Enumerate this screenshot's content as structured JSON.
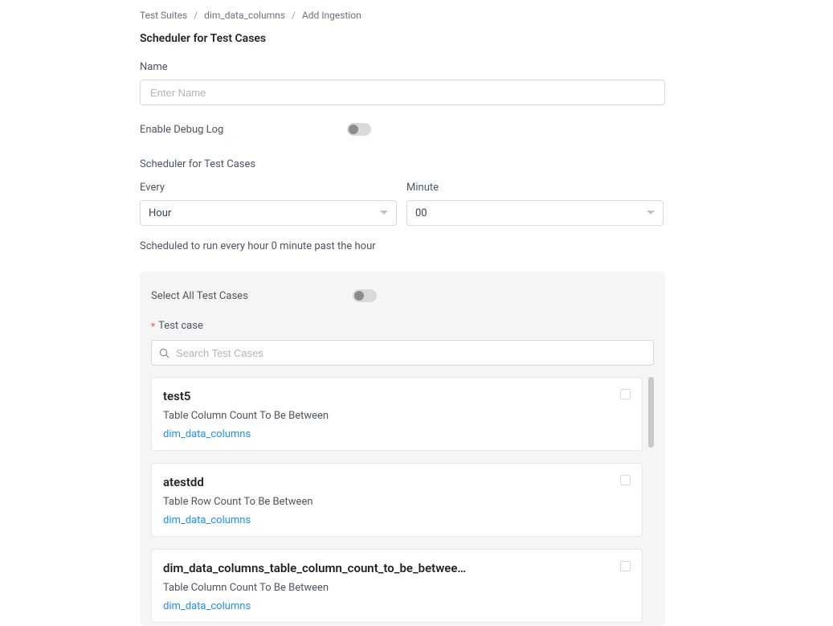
{
  "breadcrumb": {
    "items": [
      "Test Suites",
      "dim_data_columns",
      "Add Ingestion"
    ]
  },
  "header": {
    "title": "Scheduler for Test Cases"
  },
  "form": {
    "name_label": "Name",
    "name_placeholder": "Enter Name",
    "debug_log_label": "Enable Debug Log",
    "scheduler_heading": "Scheduler for Test Cases",
    "every_label": "Every",
    "every_value": "Hour",
    "minute_label": "Minute",
    "minute_value": "00",
    "schedule_desc": "Scheduled to run every hour 0 minute past the hour"
  },
  "panel": {
    "select_all_label": "Select All Test Cases",
    "test_case_label": "Test case",
    "search_placeholder": "Search Test Cases"
  },
  "test_cases": [
    {
      "title": "test5",
      "subtitle": "Table Column Count To Be Between",
      "link": "dim_data_columns"
    },
    {
      "title": "atestdd",
      "subtitle": "Table Row Count To Be Between",
      "link": "dim_data_columns"
    },
    {
      "title": "dim_data_columns_table_column_count_to_be_betwee…",
      "subtitle": "Table Column Count To Be Between",
      "link": "dim_data_columns"
    }
  ]
}
